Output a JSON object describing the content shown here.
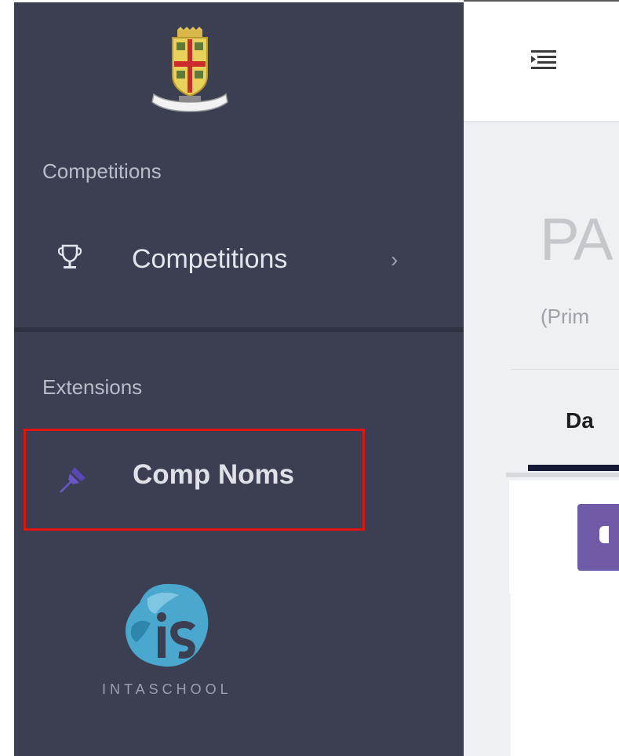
{
  "sidebar": {
    "sections": [
      {
        "label": "Competitions"
      },
      {
        "label": "Extensions"
      }
    ],
    "items": [
      {
        "label": "Competitions",
        "icon": "trophy-icon",
        "chevron": "›"
      },
      {
        "label": "Comp Noms",
        "icon": "pin-icon",
        "highlighted": true
      }
    ],
    "footer_brand": "INTASCHOOL"
  },
  "main": {
    "title": "PA",
    "subtitle": "(Prim",
    "tabs": [
      {
        "label": "Da",
        "active": true
      }
    ]
  },
  "colors": {
    "sidebar_bg": "#3b3f51",
    "highlight_border": "#e21313",
    "accent_purple": "#6f5aa8",
    "pin_color": "#6a55c9",
    "active_tab_underline": "#141a33"
  }
}
